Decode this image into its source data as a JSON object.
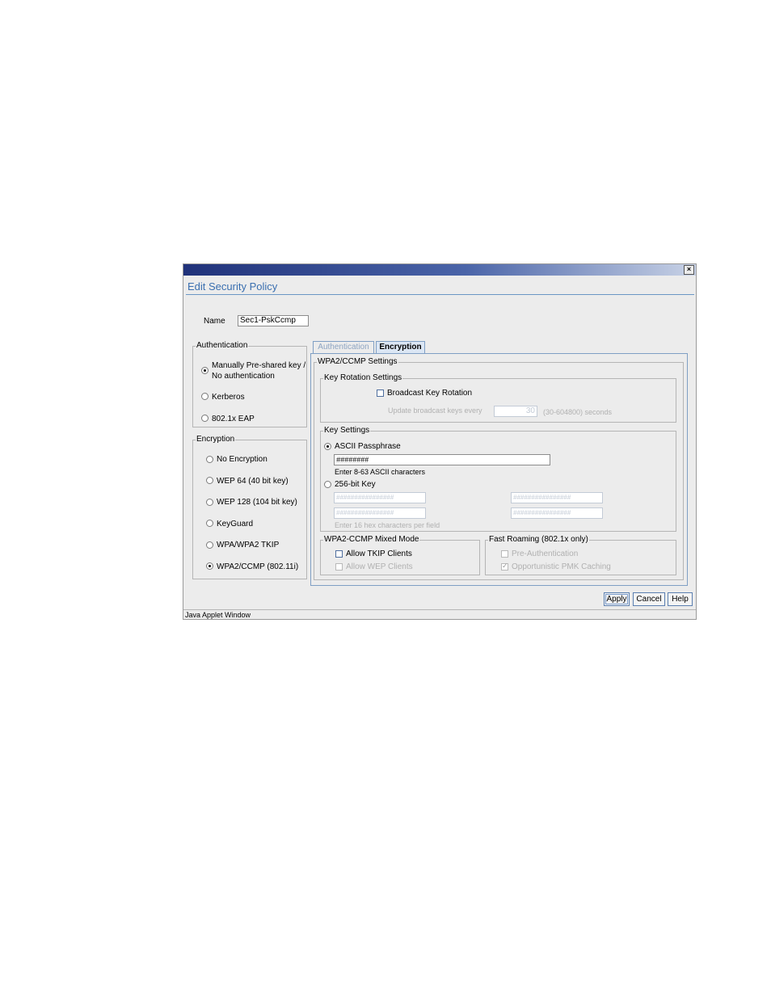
{
  "window": {
    "close_glyph": "×",
    "title": "Edit Security Policy",
    "status": "Java Applet Window"
  },
  "name_field": {
    "label": "Name",
    "value": "Sec1-PskCcmp"
  },
  "authentication": {
    "title": "Authentication",
    "options": [
      {
        "label": "Manually Pre-shared key /",
        "label2": "No authentication",
        "selected": true
      },
      {
        "label": "Kerberos",
        "selected": false
      },
      {
        "label": "802.1x EAP",
        "selected": false
      }
    ]
  },
  "encryption": {
    "title": "Encryption",
    "options": [
      {
        "label": "No Encryption",
        "selected": false
      },
      {
        "label": "WEP 64 (40 bit key)",
        "selected": false
      },
      {
        "label": "WEP 128 (104 bit key)",
        "selected": false
      },
      {
        "label": "KeyGuard",
        "selected": false
      },
      {
        "label": "WPA/WPA2 TKIP",
        "selected": false
      },
      {
        "label": "WPA2/CCMP (802.11i)",
        "selected": true
      }
    ]
  },
  "tabs": [
    {
      "label": "Authentication",
      "active": false
    },
    {
      "label": "Encryption",
      "active": true
    }
  ],
  "wpa2": {
    "title": "WPA2/CCMP Settings",
    "key_rotation": {
      "title": "Key Rotation Settings",
      "broadcast_label": "Broadcast Key Rotation",
      "broadcast_checked": false,
      "update_label": "Update broadcast keys every",
      "update_value": "30",
      "update_range": "(30-604800) seconds"
    },
    "key_settings": {
      "title": "Key Settings",
      "ascii_label": "ASCII Passphrase",
      "ascii_selected": true,
      "ascii_value": "########",
      "ascii_hint": "Enter 8-63 ASCII characters",
      "key256_label": "256-bit Key",
      "key256_selected": false,
      "hex_fields": [
        "################",
        "################",
        "################",
        "################"
      ],
      "hex_hint": "Enter 16 hex characters per field"
    },
    "mixed_mode": {
      "title": "WPA2-CCMP Mixed Mode",
      "tkip_label": "Allow TKIP Clients",
      "tkip_checked": false,
      "wep_label": "Allow WEP Clients",
      "wep_checked": false
    },
    "fast_roaming": {
      "title": "Fast Roaming (802.1x only)",
      "preauth_label": "Pre-Authentication",
      "preauth_checked": false,
      "pmk_label": "Opportunistic PMK Caching",
      "pmk_checked": true
    }
  },
  "buttons": {
    "apply": "Apply",
    "cancel": "Cancel",
    "help": "Help"
  }
}
